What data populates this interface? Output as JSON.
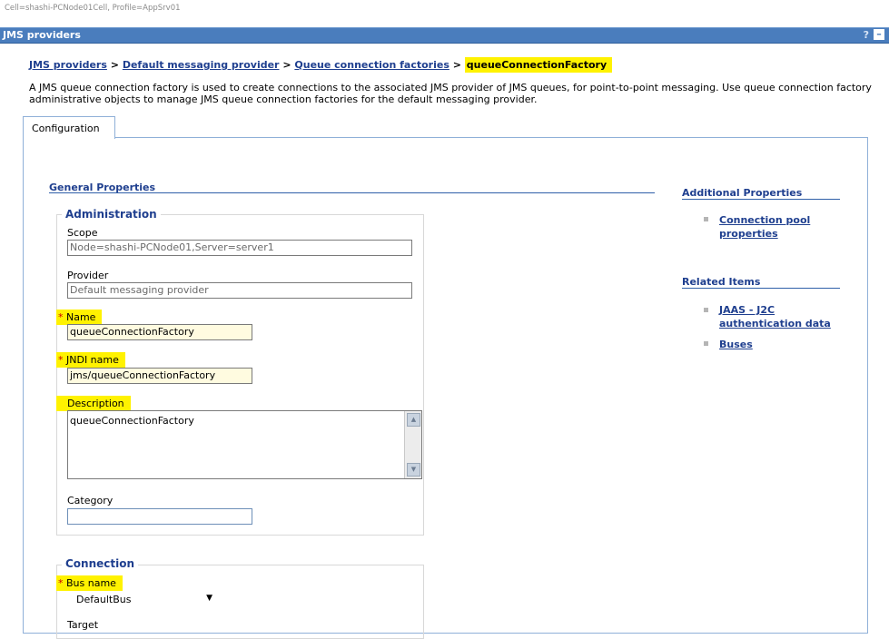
{
  "cell_info": "Cell=shashi-PCNode01Cell, Profile=AppSrv01",
  "panel": {
    "title": "JMS providers",
    "help": "?",
    "minimize": "–"
  },
  "breadcrumb": {
    "items": [
      "JMS providers",
      "Default messaging provider",
      "Queue connection factories"
    ],
    "separator": ">",
    "current": "queueConnectionFactory"
  },
  "description_text": "A JMS queue connection factory is used to create connections to the associated JMS provider of JMS queues, for point-to-point messaging. Use queue connection factory administrative objects to manage JMS queue connection factories for the default messaging provider.",
  "tabs": [
    {
      "label": "Configuration"
    }
  ],
  "general_properties": {
    "title": "General Properties",
    "administration": {
      "legend": "Administration",
      "scope": {
        "label": "Scope",
        "value": "Node=shashi-PCNode01,Server=server1"
      },
      "provider": {
        "label": "Provider",
        "value": "Default messaging provider"
      },
      "name": {
        "required": "*",
        "label": "Name",
        "value": "queueConnectionFactory"
      },
      "jndi": {
        "required": "*",
        "label": "JNDI name",
        "value": "jms/queueConnectionFactory"
      },
      "description": {
        "label": "Description",
        "value": "queueConnectionFactory"
      },
      "category": {
        "label": "Category",
        "value": ""
      }
    },
    "connection": {
      "legend": "Connection",
      "bus_name": {
        "required": "*",
        "label": "Bus name",
        "value": "DefaultBus"
      },
      "cutoff_label": "Target"
    }
  },
  "additional_properties": {
    "title": "Additional Properties",
    "links": [
      "Connection pool properties"
    ]
  },
  "related_items": {
    "title": "Related Items",
    "links": [
      "JAAS - J2C authentication data",
      "Buses"
    ]
  },
  "colors": {
    "header_bg": "#4a7dbd",
    "link": "#1f3f8f",
    "highlight": "#fff200"
  }
}
